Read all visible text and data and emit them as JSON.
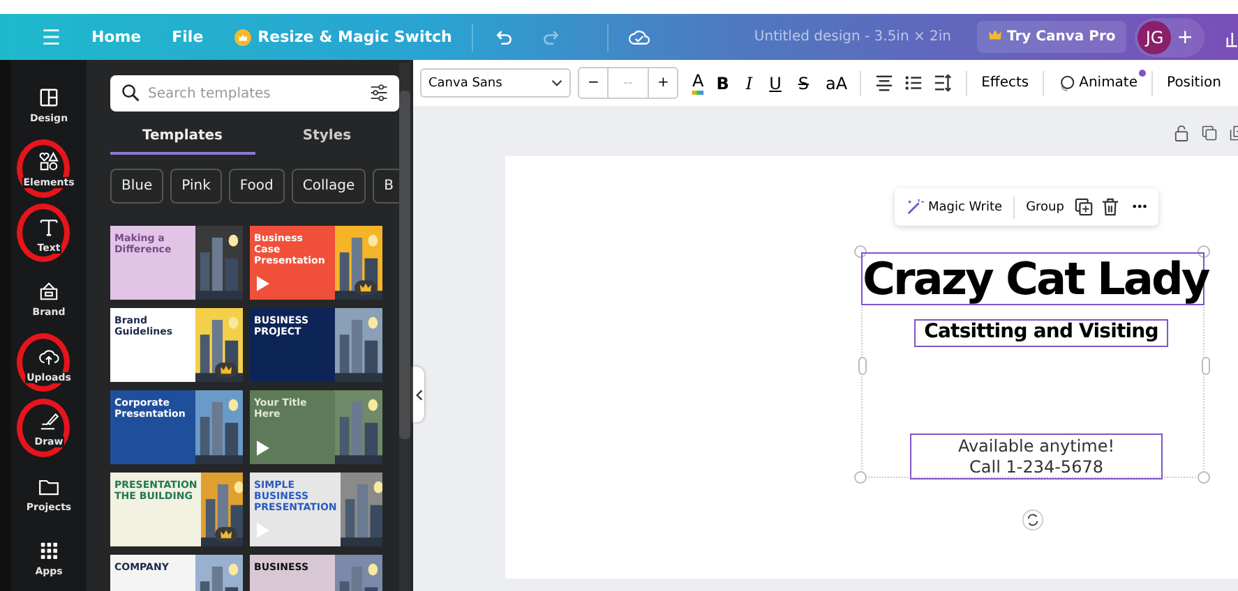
{
  "header": {
    "menu_icon": "☰",
    "links": [
      "Home",
      "File"
    ],
    "resize": "Resize & Magic Switch",
    "title": "Untitled design - 3.5in × 2in",
    "pro": "Try Canva Pro",
    "avatar": "JG",
    "add": "+"
  },
  "sidebar": [
    {
      "kind": "design",
      "label": "Design",
      "circled": false
    },
    {
      "kind": "elements",
      "label": "Elements",
      "circled": true
    },
    {
      "kind": "text",
      "label": "Text",
      "circled": true
    },
    {
      "kind": "brand",
      "label": "Brand",
      "circled": false
    },
    {
      "kind": "uploads",
      "label": "Uploads",
      "circled": true
    },
    {
      "kind": "draw",
      "label": "Draw",
      "circled": true
    },
    {
      "kind": "projects",
      "label": "Projects",
      "circled": false
    },
    {
      "kind": "apps",
      "label": "Apps",
      "circled": false
    }
  ],
  "panel": {
    "search": {
      "placeholder": "Search templates"
    },
    "tabs": [
      {
        "label": "Templates",
        "selected": true
      },
      {
        "label": "Styles",
        "selected": false
      }
    ],
    "chips": [
      "Blue",
      "Pink",
      "Food",
      "Collage",
      "B"
    ],
    "templates": [
      {
        "title": "Making a Difference",
        "play": false,
        "crown": false
      },
      {
        "title": "Business Case Presentation",
        "play": true,
        "crown": true
      },
      {
        "title": "Brand Guidelines",
        "play": false,
        "crown": true
      },
      {
        "title": "BUSINESS PROJECT",
        "play": false,
        "crown": false
      },
      {
        "title": "Corporate Presentation",
        "play": false,
        "crown": false
      },
      {
        "title": "Your Title Here",
        "play": true,
        "crown": false
      },
      {
        "title": "PRESENTATION THE BUILDING",
        "play": false,
        "crown": true
      },
      {
        "title": "SIMPLE BUSINESS PRESENTATION",
        "play": true,
        "crown": false
      },
      {
        "title": "COMPANY",
        "play": false,
        "crown": false
      },
      {
        "title": "BUSINESS",
        "play": false,
        "crown": false
      }
    ]
  },
  "toolbar": {
    "font": "Canva Sans",
    "text_color_letter": "A",
    "minus": "−",
    "size": "--",
    "plus": "+",
    "bold": "B",
    "italic": "I",
    "underline": "U",
    "strike": "S",
    "case": "aA",
    "effects": "Effects",
    "animate": "Animate",
    "position": "Position"
  },
  "design": {
    "floating": {
      "magic": "Magic Write",
      "group": "Group",
      "more": "•••"
    },
    "title": "Crazy Cat Lady",
    "subtitle": "Catsitting and Visiting",
    "lines": [
      "Available anytime!",
      "Call 1-234-5678"
    ]
  }
}
